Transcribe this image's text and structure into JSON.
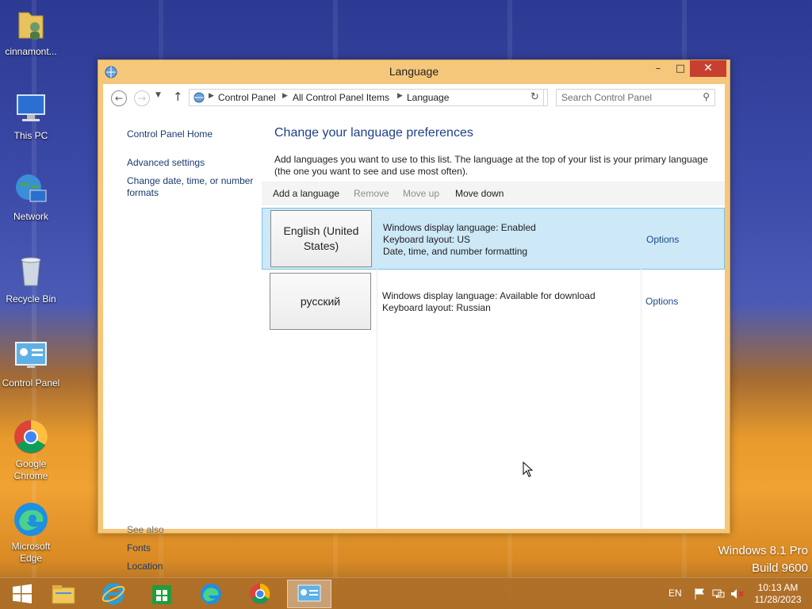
{
  "desktop": {
    "icons": [
      {
        "label": "cinnamont...",
        "icon": "user-folder-icon"
      },
      {
        "label": "This PC",
        "icon": "computer-icon"
      },
      {
        "label": "Network",
        "icon": "network-icon"
      },
      {
        "label": "Recycle Bin",
        "icon": "recycle-bin-icon"
      },
      {
        "label": "Control Panel",
        "icon": "control-panel-icon"
      },
      {
        "label": "Google Chrome",
        "icon": "chrome-icon"
      },
      {
        "label": "Microsoft Edge",
        "icon": "edge-icon"
      }
    ],
    "watermark": {
      "line1": "Windows 8.1 Pro",
      "line2": "Build 9600"
    }
  },
  "window": {
    "title": "Language",
    "buttons": {
      "minimize": "–",
      "maximize": "□",
      "close": "✕"
    },
    "address": {
      "crumbs": [
        "Control Panel",
        "All Control Panel Items",
        "Language"
      ]
    },
    "search": {
      "placeholder": "Search Control Panel"
    },
    "left_pane": {
      "home": "Control Panel Home",
      "links": [
        "Advanced settings",
        "Change date, time, or number formats"
      ],
      "see_also_label": "See also",
      "see_also": [
        "Fonts",
        "Location"
      ]
    },
    "main": {
      "heading": "Change your language preferences",
      "description": "Add languages you want to use to this list. The language at the top of your list is your primary language (the one you want to see and use most often).",
      "toolbar": {
        "add": "Add a language",
        "remove": "Remove",
        "move_up": "Move up",
        "move_down": "Move down"
      },
      "languages": [
        {
          "name": "English (United States)",
          "details": [
            "Windows display language: Enabled",
            "Keyboard layout: US",
            "Date, time, and number formatting"
          ],
          "options": "Options",
          "selected": true
        },
        {
          "name": "русский",
          "details": [
            "Windows display language: Available for download",
            "Keyboard layout: Russian"
          ],
          "options": "Options",
          "selected": false
        }
      ]
    }
  },
  "taskbar": {
    "items": [
      "start-icon",
      "file-explorer-icon",
      "internet-explorer-icon",
      "store-icon",
      "edge-icon",
      "chrome-icon",
      "control-panel-icon"
    ],
    "tray": {
      "language": "EN",
      "time": "10:13 AM",
      "date": "11/28/2023"
    }
  }
}
